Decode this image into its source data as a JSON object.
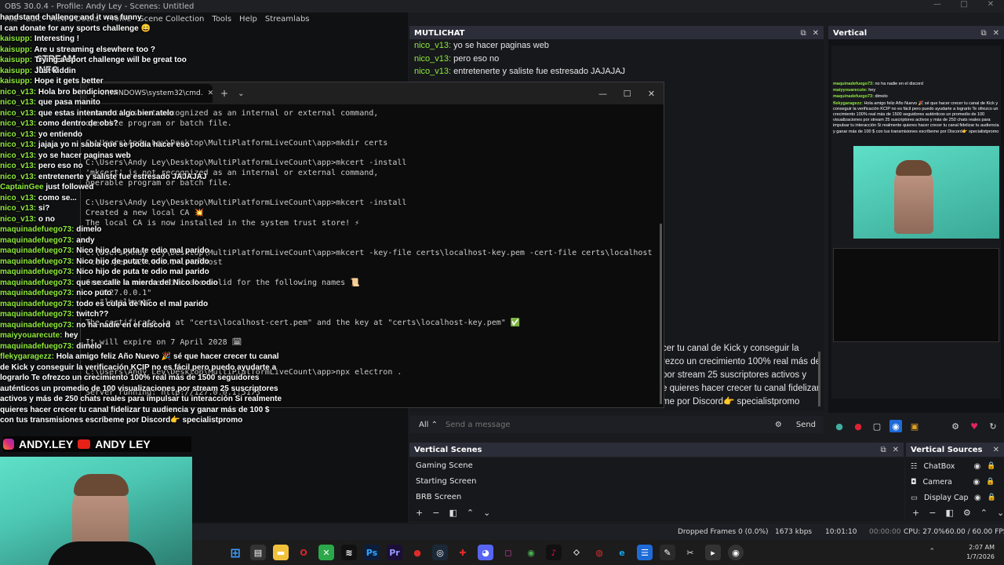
{
  "obs": {
    "title": "OBS 30.0.4 - Profile: Andy Ley - Scenes: Untitled",
    "menu": [
      "File",
      "Edit",
      "View",
      "Docks",
      "Profile",
      "Scene Collection",
      "Tools",
      "Help",
      "Streamlabs"
    ],
    "window_controls": [
      "—",
      "□",
      "✕"
    ]
  },
  "stream_overlay": {
    "labels": [
      "STREAM",
      "INFO"
    ],
    "chat": [
      {
        "user": "",
        "text": "handstand challenge and it was funny"
      },
      {
        "user": "",
        "text": "I can donate for any sports challenge 😄"
      },
      {
        "user": "kaisupp:",
        "text": "Interesting !"
      },
      {
        "user": "kaisupp:",
        "text": "Are u streaming elsewhere too ?"
      },
      {
        "user": "kaisupp:",
        "text": "Trying a sport challenge will be great too"
      },
      {
        "user": "kaisupp:",
        "text": "Just kiddin"
      },
      {
        "user": "kaisupp:",
        "text": "Hope it gets better"
      },
      {
        "user": "nico_v13:",
        "text": "Hola bro bendiciones"
      },
      {
        "user": "nico_v13:",
        "text": "que pasa manito"
      },
      {
        "user": "nico_v13:",
        "text": "que estas intentando algo bien atelo"
      },
      {
        "user": "nico_v13:",
        "text": "como dentro de obs?"
      },
      {
        "user": "nico_v13:",
        "text": "yo entiendo"
      },
      {
        "user": "nico_v13:",
        "text": "jajaja yo ni sabia que se podia hacer eso"
      },
      {
        "user": "nico_v13:",
        "text": "yo se hacer paginas web"
      },
      {
        "user": "nico_v13:",
        "text": "pero eso no"
      },
      {
        "user": "nico_v13:",
        "text": "entretenerte y saliste fue estresado JAJAJAJ"
      },
      {
        "user": "CaptainGee",
        "text": "just followed"
      },
      {
        "user": "nico_v13:",
        "text": "como se..."
      },
      {
        "user": "nico_v13:",
        "text": "si?"
      },
      {
        "user": "nico_v13:",
        "text": "o no"
      },
      {
        "user": "maquinadefuego73:",
        "text": "dimelo"
      },
      {
        "user": "maquinadefuego73:",
        "text": "andy"
      },
      {
        "user": "maquinadefuego73:",
        "text": "Nico hijo de puta te odio mal parido"
      },
      {
        "user": "maquinadefuego73:",
        "text": "Nico hijo de puta te odio mal parido"
      },
      {
        "user": "maquinadefuego73:",
        "text": "Nico hijo de puta te odio mal parido"
      },
      {
        "user": "maquinadefuego73:",
        "text": "que se calle la mierda del Nico lo odio"
      },
      {
        "user": "maquinadefuego73:",
        "text": "nico puto"
      },
      {
        "user": "maquinadefuego73:",
        "text": "todo es culpa de Nico el mal parido"
      },
      {
        "user": "maquinadefuego73:",
        "text": "twitch??"
      },
      {
        "user": "maquinadefuego73:",
        "text": "no ha nadie en el discord"
      },
      {
        "user": "maiyyouarecute:",
        "text": "hey"
      },
      {
        "user": "maquinadefuego73:",
        "text": "dimelo"
      }
    ],
    "promo_user": "flekygaragezz:",
    "promo_text": "Hola amigo feliz Año Nuevo 🎉 sé que hacer crecer tu canal de Kick y conseguir la verificación KCIP no es fácil pero puedo ayudarte a lograrlo Te ofrezco un crecimiento 100% real más de 1500 seguidores auténticos un promedio de 100 visualizaciones por stream 25 suscriptores activos y más de 250 chats reales para impulsar tu interacción Si realmente quieres hacer crecer tu canal fidelizar tu audiencia y ganar más de 100 $ con tus transmisiones escríbeme por Discord👉 specialistpromo",
    "social": [
      "ANDY.LEY",
      "ANDY LEY"
    ]
  },
  "cmd": {
    "tab_title": "C:\\WINDOWS\\system32\\cmd.",
    "lines": [
      "'mkcert' is not recognized as an internal or external command,",
      "operable program or batch file.",
      "",
      "C:\\Users\\Andy Ley\\Desktop\\MultiPlatformLiveCount\\app>mkdir certs",
      "",
      "C:\\Users\\Andy Ley\\Desktop\\MultiPlatformLiveCount\\app>mkcert -install",
      "'mkcert' is not recognized as an internal or external command,",
      "operable program or batch file.",
      "",
      "C:\\Users\\Andy Ley\\Desktop\\MultiPlatformLiveCount\\app>mkcert -install",
      "Created a new local CA 💥",
      "The local CA is now installed in the system trust store! ⚡",
      "",
      "",
      "C:\\Users\\Andy Ley\\Desktop\\MultiPlatformLiveCount\\app>mkcert -key-file certs\\localhost-key.pem -cert-file certs\\localhost",
      "-cert.pem 127.0.0.1 localhost",
      "",
      "Created a new certificate valid for the following names 📜",
      " - \"127.0.0.1\"",
      " - \"localhost\"",
      "",
      "The certificate is at \"certs\\localhost-cert.pem\" and the key at \"certs\\localhost-key.pem\" ✅",
      "",
      "It will expire on 7 April 2028 🗓",
      "",
      "",
      "C:\\Users\\Andy Ley\\Desktop\\MultiPlatformLiveCount\\app>npx electron .",
      "",
      "Server running: http://127.0.0.1:5173"
    ]
  },
  "multichat": {
    "title": "MUTLICHAT",
    "messages": [
      {
        "user": "nico_v13:",
        "text": "yo se hacer paginas web"
      },
      {
        "user": "nico_v13:",
        "text": "pero eso no"
      },
      {
        "user": "nico_v13:",
        "text": "entretenerte y saliste fue estresado JAJAJAJ"
      }
    ],
    "partial_lines": [
      "cer tu canal de Kick y conseguir la",
      "rezco un crecimiento 100% real más de",
      "por stream 25 suscriptores activos y",
      "e quieres hacer crecer tu canal fidelizar",
      "me por Discord👉 specialistpromo"
    ],
    "filter": "All",
    "input_placeholder": "Send a message",
    "send_label": "Send"
  },
  "vertical": {
    "title": "Vertical",
    "chat": [
      {
        "user": "maquinadefuego73:",
        "text": "no ha nadie en el discord"
      },
      {
        "user": "maiyyouarecute:",
        "text": "hey"
      },
      {
        "user": "maquinadefuego73:",
        "text": "dimelo"
      },
      {
        "user": "flekygaragezz:",
        "text": "Hola amigo feliz Año Nuevo 🎉 sé que hacer crecer tu canal de Kick y conseguir la verificación KCIP no es fácil pero puedo ayudarte a lograrlo Te ofrezco un crecimiento 100% real más de 1500 seguidores auténticos un promedio de 100 visualizaciones por stream 25 suscriptores activos y más de 250 chats reales para impulsar tu interacción Si realmente quieres hacer crecer tu canal fidelizar tu audiencia y ganar más de 100 $ con tus transmisiones escríbeme por Discord👉 specialistpromo"
      }
    ]
  },
  "vertical_scenes": {
    "title": "Vertical Scenes",
    "items": [
      "Gaming Scene",
      "Starting Screen",
      "BRB Screen"
    ]
  },
  "vertical_sources": {
    "title": "Vertical Sources",
    "items": [
      "ChatBox",
      "Camera",
      "Display Cap"
    ]
  },
  "status": {
    "dropped_frames": "Dropped Frames 0 (0.0%)",
    "bitrate": "1673 kbps",
    "stream_time": "10:01:10",
    "rec_time": "00:00:00",
    "cpu": "CPU: 27.0%",
    "fps": "60.00 / 60.00 FPS"
  },
  "taskbar": {
    "time": "2:07 AM",
    "date": "1/7/2026"
  },
  "colors": {
    "chat_user": "#8fea3c",
    "panel_header": "#2b2e38",
    "cmd_bg": "#0c0c0c",
    "accent_blue": "#1e6bd8"
  }
}
